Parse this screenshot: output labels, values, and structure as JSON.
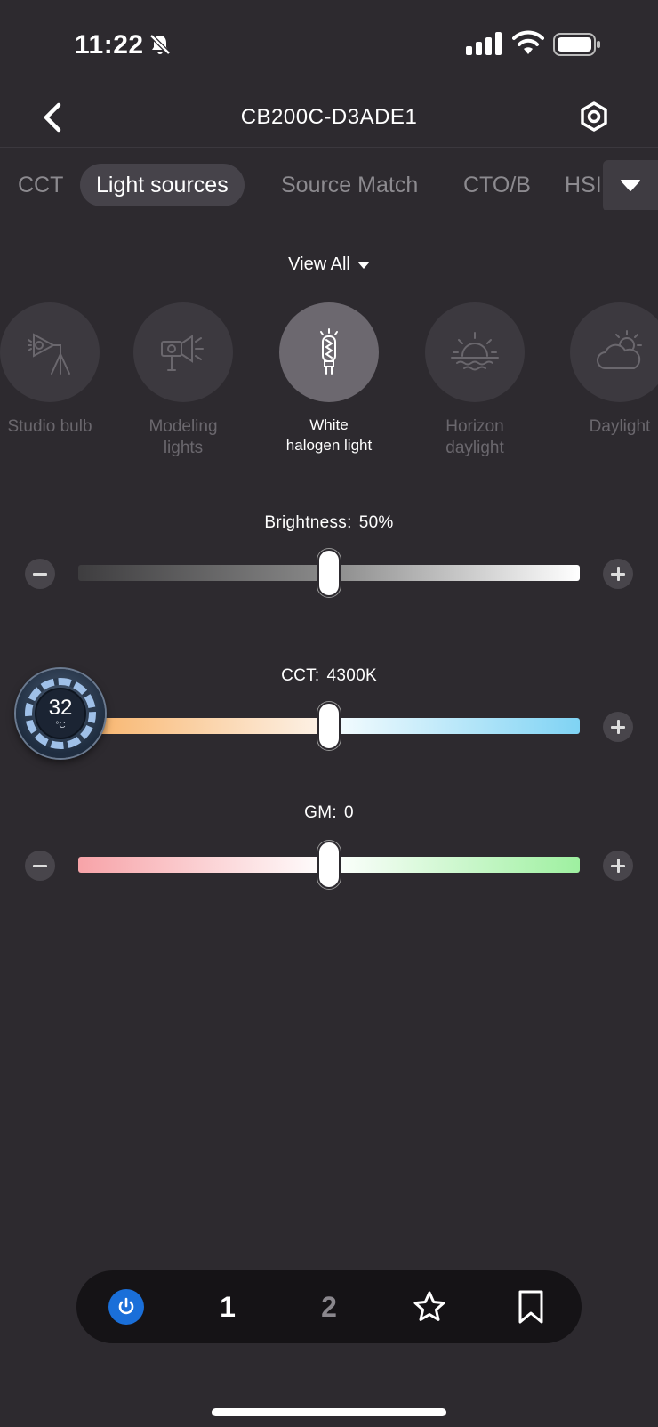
{
  "status_bar": {
    "time": "11:22",
    "icons": [
      "bell-slash-icon",
      "cellular-signal-icon",
      "wifi-icon",
      "battery-icon"
    ]
  },
  "nav": {
    "title": "CB200C-D3ADE1",
    "back_icon": "chevron-left-icon",
    "settings_icon": "hexagon-gear-icon"
  },
  "tabs": [
    {
      "label": "CCT",
      "active": false
    },
    {
      "label": "Light sources",
      "active": true
    },
    {
      "label": "Source Match",
      "active": false
    },
    {
      "label": "CTO/B",
      "active": false
    },
    {
      "label": "HSI",
      "active": false
    }
  ],
  "view_all": {
    "label": "View All"
  },
  "sources": [
    {
      "label": "Studio bulb",
      "icon": "studio-bulb-icon",
      "selected": false
    },
    {
      "label": "Modeling\nlights",
      "icon": "modeling-light-icon",
      "selected": false
    },
    {
      "label": "White\nhalogen light",
      "icon": "halogen-bulb-icon",
      "selected": true
    },
    {
      "label": "Horizon\ndaylight",
      "icon": "horizon-sun-icon",
      "selected": false
    },
    {
      "label": "Daylight",
      "icon": "sun-cloud-icon",
      "selected": false
    }
  ],
  "sliders": {
    "brightness": {
      "label": "Brightness:",
      "value": "50%",
      "position": 0.5
    },
    "cct": {
      "label": "CCT:",
      "value": "4300K",
      "position": 0.5
    },
    "gm": {
      "label": "GM:",
      "value": "0",
      "position": 0.5
    }
  },
  "temperature": {
    "value": "32",
    "unit": "°C"
  },
  "bottom_bar": {
    "power_icon": "power-icon",
    "group_1": "1",
    "group_2": "2",
    "favorite_icon": "star-icon",
    "bookmark_icon": "bookmark-icon"
  },
  "colors": {
    "background": "#2d2a2f",
    "power_blue": "#1a6fd9"
  }
}
